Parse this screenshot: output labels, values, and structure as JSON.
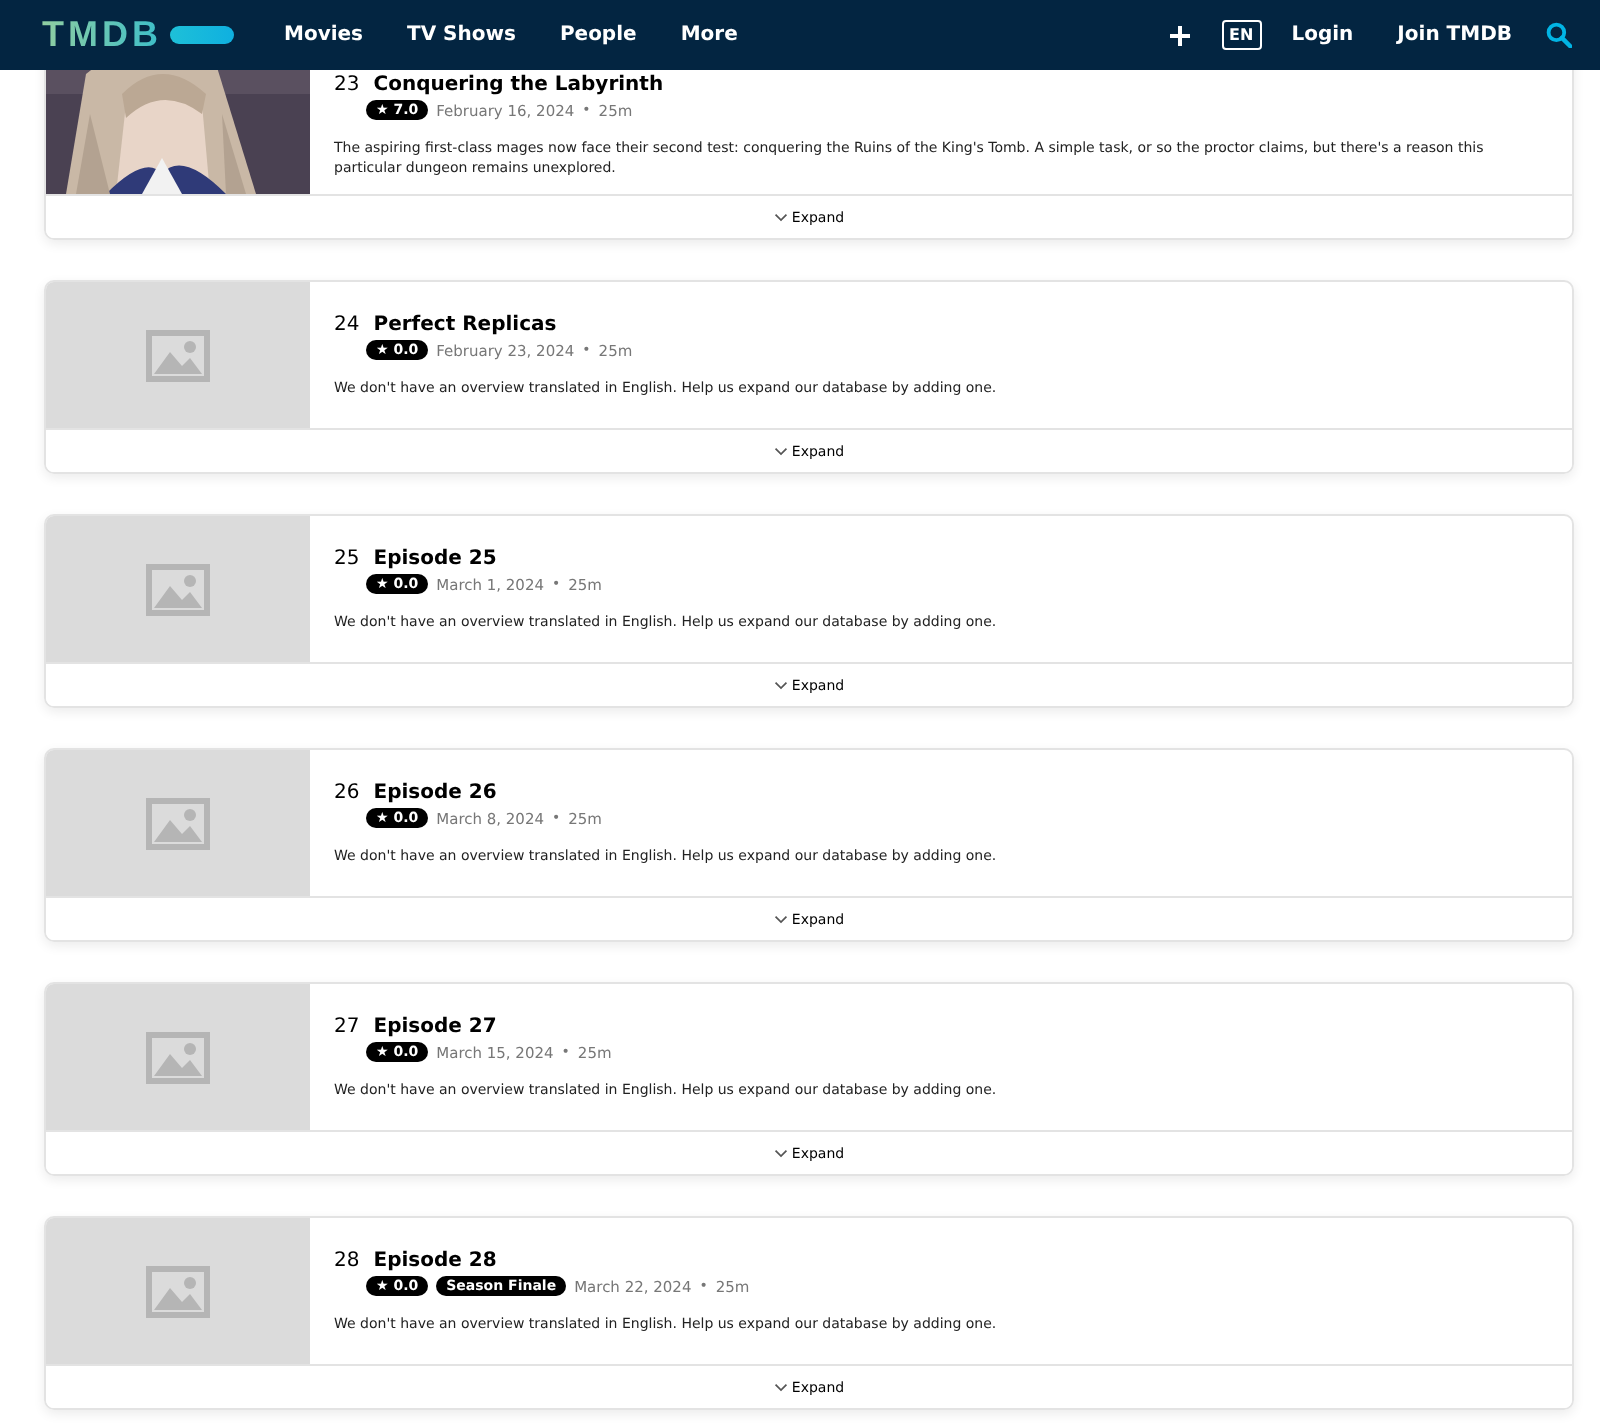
{
  "header": {
    "logo": "TMDB",
    "nav": [
      "Movies",
      "TV Shows",
      "People",
      "More"
    ],
    "language": "EN",
    "links": [
      "Login",
      "Join TMDB"
    ]
  },
  "episodes": [
    {
      "number": "23",
      "title": "Conquering the Labyrinth",
      "rating": "★ 7.0",
      "date": "February 16, 2024",
      "separator": "•",
      "runtime": "25m",
      "overview": "The aspiring first-class mages now face their second test: conquering the Ruins of the King's Tomb. A simple task, or so the proctor claims, but there's a reason this particular dungeon remains unexplored.",
      "kind": "picture",
      "expand": "Expand"
    },
    {
      "number": "24",
      "title": "Perfect Replicas",
      "rating": "★ 0.0",
      "date": "February 23, 2024",
      "separator": "•",
      "runtime": "25m",
      "overview": "We don't have an overview translated in English. Help us expand our database by adding one.",
      "expand": "Expand"
    },
    {
      "number": "25",
      "title": "Episode 25",
      "rating": "★ 0.0",
      "date": "March 1, 2024",
      "separator": "•",
      "runtime": "25m",
      "overview": "We don't have an overview translated in English. Help us expand our database by adding one.",
      "expand": "Expand"
    },
    {
      "number": "26",
      "title": "Episode 26",
      "rating": "★ 0.0",
      "date": "March 8, 2024",
      "separator": "•",
      "runtime": "25m",
      "overview": "We don't have an overview translated in English. Help us expand our database by adding one.",
      "expand": "Expand"
    },
    {
      "number": "27",
      "title": "Episode 27",
      "rating": "★ 0.0",
      "date": "March 15, 2024",
      "separator": "•",
      "runtime": "25m",
      "overview": "We don't have an overview translated in English. Help us expand our database by adding one.",
      "expand": "Expand"
    },
    {
      "number": "28",
      "title": "Episode 28",
      "rating": "★ 0.0",
      "tag": "Season Finale",
      "date": "March 22, 2024",
      "separator": "•",
      "runtime": "25m",
      "overview": "We don't have an overview translated in English. Help us expand our database by adding one.",
      "expand": "Expand"
    }
  ]
}
